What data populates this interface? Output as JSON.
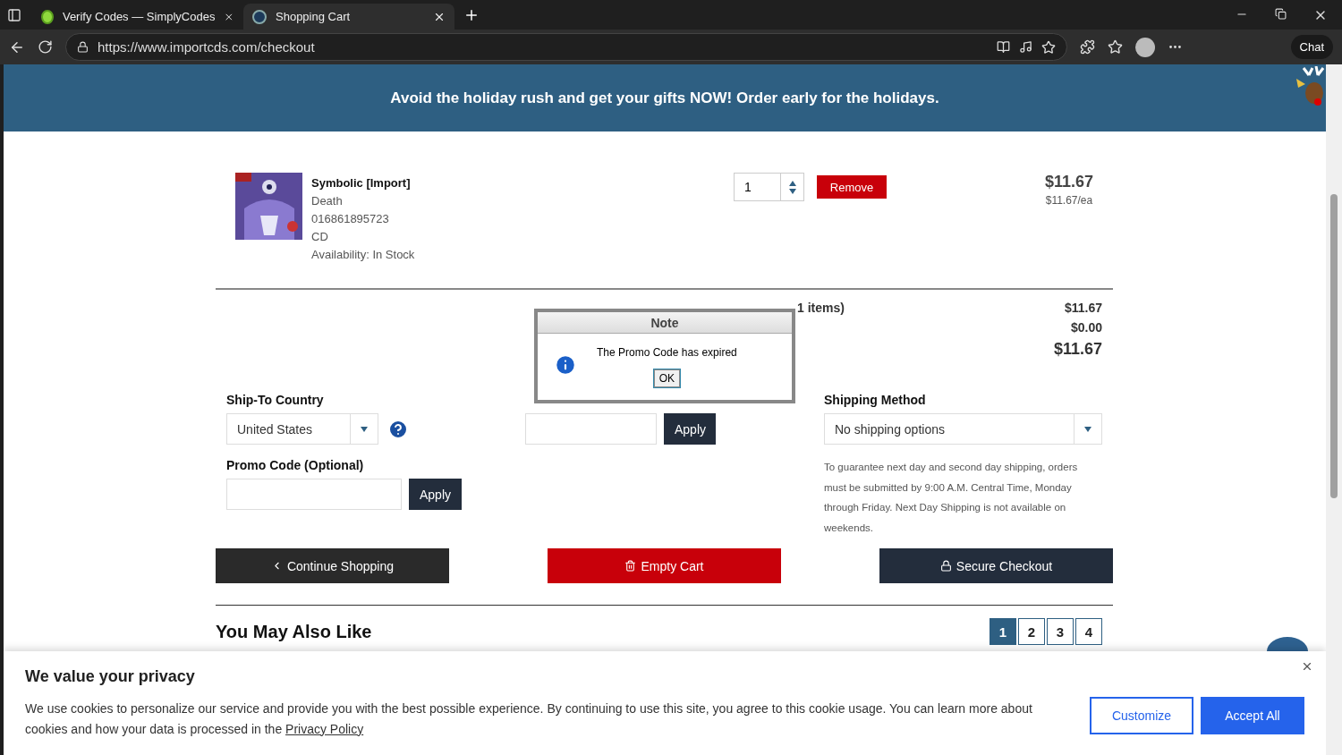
{
  "browser": {
    "tabs": [
      {
        "title": "Verify Codes — SimplyCodes",
        "selected": false,
        "kind": "simply"
      },
      {
        "title": "Shopping Cart",
        "selected": true,
        "kind": "cd"
      }
    ],
    "url": "https://www.importcds.com/checkout",
    "chat_label": "Chat"
  },
  "banner": {
    "text": "Avoid the holiday rush and get your gifts NOW! Order early for the holidays."
  },
  "cart_items": [
    {
      "title": "Symbolic [Import]",
      "artist": "Death",
      "upc": "016861895723",
      "format": "CD",
      "availability": "Availability: In Stock",
      "qty": "1",
      "remove": "Remove",
      "price": "$11.67",
      "each": "$11.67/ea"
    }
  ],
  "summary": {
    "label": "1 items)",
    "lines": [
      {
        "value": "$11.67",
        "kind": "line"
      },
      {
        "value": "$0.00",
        "kind": "line"
      },
      {
        "value": "$11.67",
        "kind": "total"
      }
    ]
  },
  "ship_country": {
    "label": "Ship-To Country",
    "value": "United States"
  },
  "zip": {
    "apply": "Apply"
  },
  "promo": {
    "label": "Promo Code (Optional)",
    "apply": "Apply"
  },
  "shipping_method": {
    "label": "Shipping Method",
    "value": "No shipping options",
    "note": "To guarantee next day and second day shipping, orders must be submitted by 9:00 A.M. Central Time, Monday through Friday. Next Day Shipping is not available on weekends."
  },
  "actions": [
    {
      "label": "Continue Shopping",
      "kind": "continue"
    },
    {
      "label": "Empty Cart",
      "kind": "empty"
    },
    {
      "label": "Secure Checkout",
      "kind": "checkout"
    }
  ],
  "also_like": {
    "title": "You May Also Like",
    "pages": [
      {
        "label": "1",
        "selected": true
      },
      {
        "label": "2",
        "selected": false
      },
      {
        "label": "3",
        "selected": false
      },
      {
        "label": "4",
        "selected": false
      }
    ]
  },
  "dialog": {
    "title": "Note",
    "message": "The Promo Code has expired",
    "ok": "OK"
  },
  "cookie": {
    "title": "We value your privacy",
    "text": "We use cookies to personalize our service and provide you with the best possible experience. By continuing to use this site, you agree to this cookie usage. You can learn more about cookies and how your data is processed in the",
    "link": "Privacy Policy",
    "buttons": [
      {
        "label": "Customize",
        "kind": "outline"
      },
      {
        "label": "Accept All",
        "kind": "solid"
      }
    ]
  }
}
